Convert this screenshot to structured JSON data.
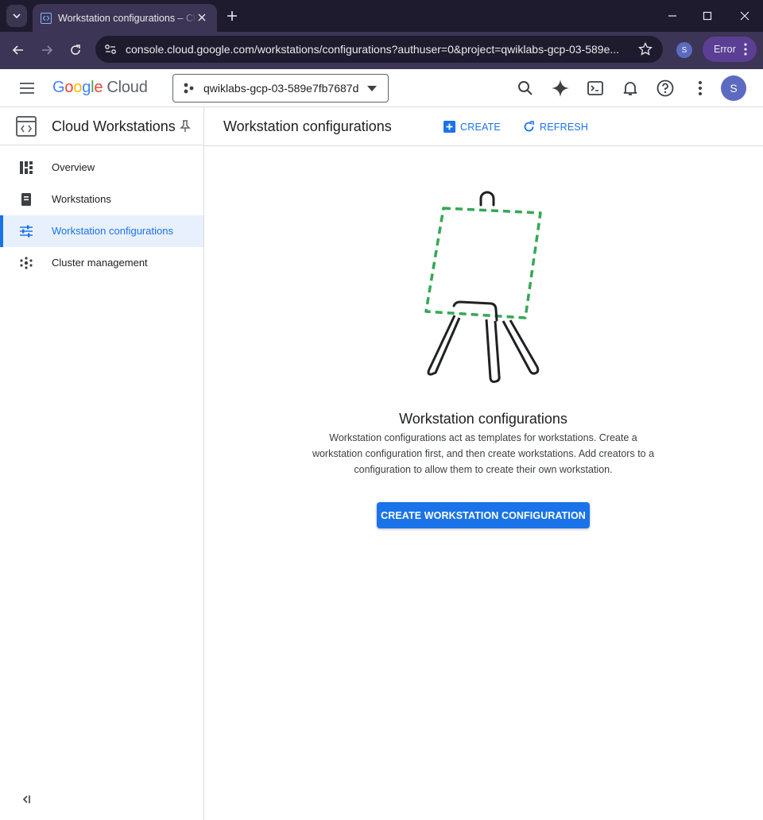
{
  "browser": {
    "tab_title": "Workstation configurations – Cloud",
    "url": "console.cloud.google.com/workstations/configurations?authuser=0&project=qwiklabs-gcp-03-589e...",
    "profile_initial": "S",
    "error_label": "Error"
  },
  "header": {
    "logo_parts": [
      "G",
      "o",
      "o",
      "g",
      "l",
      "e"
    ],
    "logo_suffix": "Cloud",
    "project": "qwiklabs-gcp-03-589e7fb7687d",
    "avatar_initial": "S"
  },
  "sidebar": {
    "product_title": "Cloud Workstations",
    "items": [
      {
        "label": "Overview",
        "icon": "dashboard-icon"
      },
      {
        "label": "Workstations",
        "icon": "workstation-icon"
      },
      {
        "label": "Workstation configurations",
        "icon": "tune-icon",
        "active": true
      },
      {
        "label": "Cluster management",
        "icon": "cluster-icon"
      }
    ]
  },
  "main": {
    "title": "Workstation configurations",
    "create_label": "CREATE",
    "refresh_label": "REFRESH",
    "empty_title": "Workstation configurations",
    "empty_desc_lines": [
      "Workstation configurations act as templates for workstations. Create a",
      "workstation configuration first, and then create workstations. Add creators to a",
      "configuration to allow them to create their own workstation."
    ],
    "cta_label": "CREATE WORKSTATION CONFIGURATION"
  },
  "colors": {
    "accent": "#1a73e8",
    "chrome_dark": "#1f1b2e",
    "chrome_toolbar": "#3c3555",
    "illustration_green": "#34a853"
  }
}
